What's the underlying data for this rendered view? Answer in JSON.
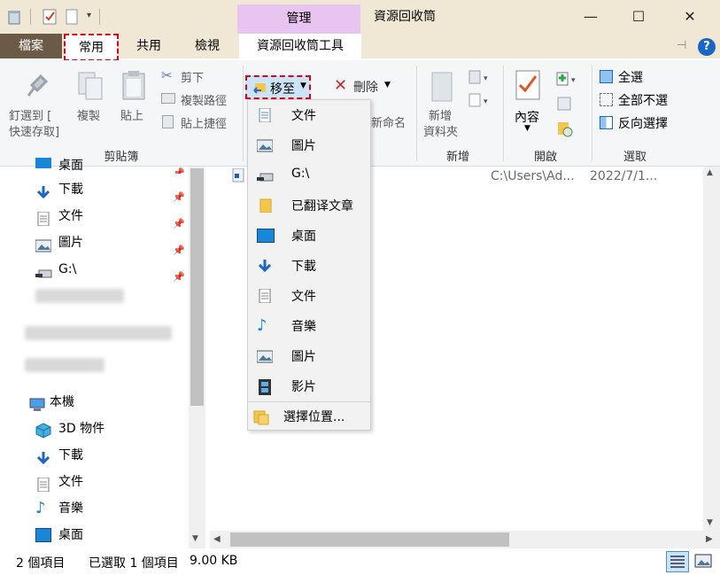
{
  "window": {
    "manage_tab": "管理",
    "title": "資源回收筒",
    "minimize": "—",
    "maximize": "☐",
    "close": "✕"
  },
  "tabs": {
    "file": "檔案",
    "home": "常用",
    "share": "共用",
    "view": "檢視",
    "tools": "資源回收筒工具"
  },
  "ribbon": {
    "pin_quick": "釘選到 [",
    "pin_quick2": "快速存取]",
    "copy": "複製",
    "paste": "貼上",
    "cut": "剪下",
    "copy_path": "複製路徑",
    "paste_shortcut": "貼上捷徑",
    "group_clipboard": "剪貼簿",
    "move_to": "移至",
    "delete": "刪除",
    "rename": "新命名",
    "new_folder": "新增",
    "new_folder2": "資料夾",
    "group_new": "新增",
    "properties": "內容",
    "group_open": "開啟",
    "select_all": "全選",
    "select_none": "全部不選",
    "invert_selection": "反向選擇",
    "group_select": "選取"
  },
  "nav": {
    "items": [
      {
        "label": "桌面"
      },
      {
        "label": "下載"
      },
      {
        "label": "文件"
      },
      {
        "label": "圖片"
      },
      {
        "label": "G:\\"
      },
      {
        "label": "本機"
      },
      {
        "label": "3D 物件"
      },
      {
        "label": "下載"
      },
      {
        "label": "文件"
      },
      {
        "label": "音樂"
      },
      {
        "label": "桌面"
      }
    ]
  },
  "content": {
    "file_path": "C:\\Users\\Ad...",
    "file_date": "2022/7/1..."
  },
  "dropdown": {
    "items": [
      {
        "label": "文件"
      },
      {
        "label": "圖片"
      },
      {
        "label": "G:\\"
      },
      {
        "label": "已翻译文章"
      },
      {
        "label": "桌面"
      },
      {
        "label": "下載"
      },
      {
        "label": "文件"
      },
      {
        "label": "音樂"
      },
      {
        "label": "圖片"
      },
      {
        "label": "影片"
      }
    ],
    "choose_location": "選擇位置..."
  },
  "status": {
    "count": "2 個項目",
    "selected": "已選取 1 個項目",
    "size": "9.00 KB"
  }
}
